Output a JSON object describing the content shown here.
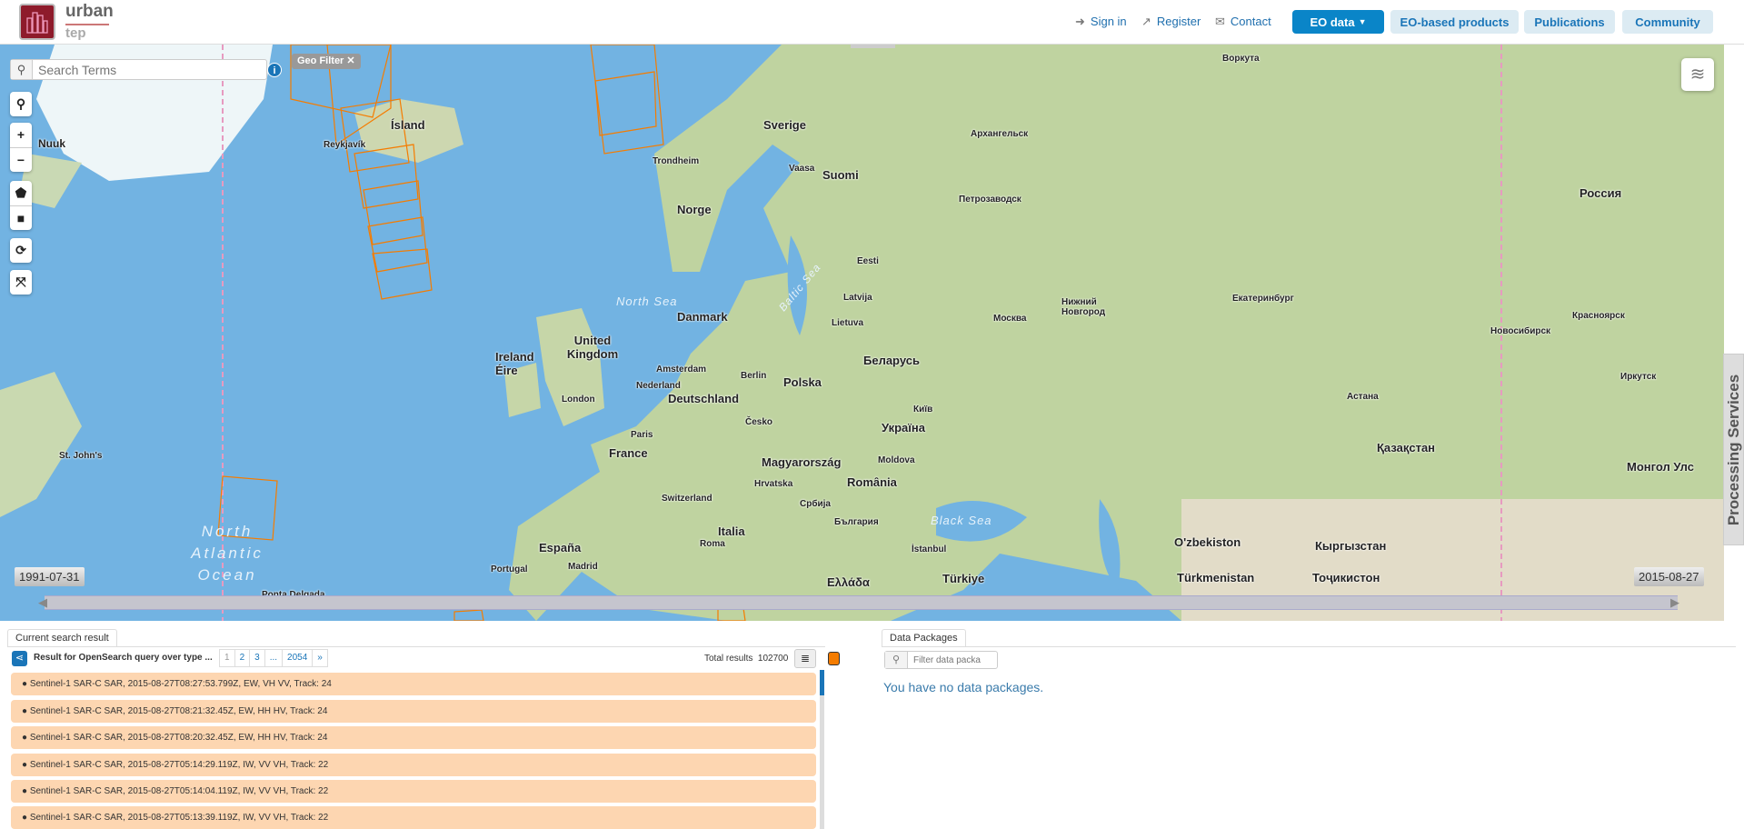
{
  "header": {
    "logo_top": "urban",
    "logo_bottom": "tep",
    "links": [
      {
        "icon": "sign-in-icon",
        "label": "Sign in"
      },
      {
        "icon": "external-link-icon",
        "label": "Register"
      },
      {
        "icon": "envelope-icon",
        "label": "Contact"
      }
    ],
    "nav": [
      {
        "label": "EO data",
        "active": true,
        "dropdown": true
      },
      {
        "label": "EO-based products"
      },
      {
        "label": "Publications"
      },
      {
        "label": "Community"
      }
    ],
    "accent": "#0a85c8"
  },
  "map": {
    "search_placeholder": "Search Terms",
    "search_value": "",
    "geo_filter": "Geo Filter ✕",
    "processing_services": "Processing Services",
    "timeline": {
      "start": "1991-07-31",
      "end": "2015-08-27"
    },
    "footprint_color": "#f57c00",
    "labels": [
      "Nuuk",
      "Ísland",
      "Reykjavík",
      "Sverige",
      "Suomi",
      "Norge",
      "Trondheim",
      "Vaasa",
      "Архангельск",
      "Воркута",
      "Петрозаводск",
      "Россия",
      "Eesti",
      "Latvija",
      "Lietuva",
      "Danmark",
      "North Sea",
      "United Kingdom",
      "Ireland Éire",
      "Nederland",
      "Deutschland",
      "Polska",
      "Беларусь",
      "Москва",
      "Нижний Новгород",
      "Екатеринбург",
      "Новосибирск",
      "Красноярск",
      "Україна",
      "Київ",
      "Астана",
      "Қазақстан",
      "France",
      "Česko",
      "Magyarország",
      "România",
      "Moldova",
      "Italia",
      "España",
      "Portugal",
      "Madrid",
      "Roma",
      "Black Sea",
      "Türkiye",
      "O'zbekiston",
      "Кыргызстан",
      "Türkmenistan",
      "Тоҷикистон",
      "Монгол Улс",
      "North Atlantic Ocean",
      "St. John's",
      "London",
      "Paris",
      "Berlin",
      "Amsterdam",
      "Switzerland",
      "Hrvatska",
      "Србија",
      "България",
      "İstanbul",
      "Ελλάδα",
      "Иркутск",
      "Ponta Delgada",
      "Baltic Sea"
    ]
  },
  "results": {
    "tab": "Current search result",
    "query": "Result for OpenSearch query over type ...",
    "pages": [
      "1",
      "2",
      "3",
      "...",
      "2054",
      "»"
    ],
    "total_label": "Total results",
    "total": "102700",
    "items": [
      "Sentinel-1 SAR-C SAR, 2015-08-27T08:27:53.799Z, EW, VH VV, Track: 24",
      "Sentinel-1 SAR-C SAR, 2015-08-27T08:21:32.45Z, EW, HH HV, Track: 24",
      "Sentinel-1 SAR-C SAR, 2015-08-27T08:20:32.45Z, EW, HH HV, Track: 24",
      "Sentinel-1 SAR-C SAR, 2015-08-27T05:14:29.119Z, IW, VV VH, Track: 22",
      "Sentinel-1 SAR-C SAR, 2015-08-27T05:14:04.119Z, IW, VV VH, Track: 22",
      "Sentinel-1 SAR-C SAR, 2015-08-27T05:13:39.119Z, IW, VV VH, Track: 22"
    ]
  },
  "packages": {
    "tab": "Data Packages",
    "filter_placeholder": "Filter data packa",
    "empty": "You have no data packages."
  }
}
